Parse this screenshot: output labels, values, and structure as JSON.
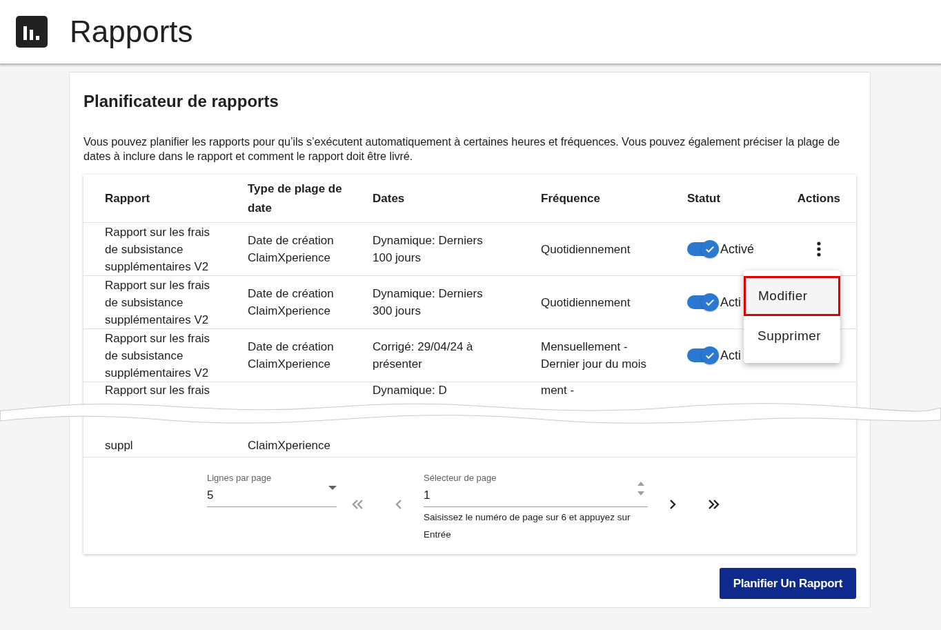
{
  "header": {
    "title": "Rapports"
  },
  "card": {
    "title": "Planificateur de rapports",
    "description": "Vous pouvez planifier les rapports pour qu’ils s’exécutent automatiquement à certaines heures et fréquences. Vous pouvez également préciser la plage de dates à inclure dans le rapport et comment le rapport doit être livré."
  },
  "table": {
    "columns": [
      "Rapport",
      "Type de plage de date",
      "Dates",
      "Fréquence",
      "Statut",
      "Actions"
    ],
    "rows": [
      {
        "report": "Rapport sur les frais de subsistance supplémentaires V2",
        "range_type": "Date de création ClaimXperience",
        "dates": "Dynamique: Derniers 100 jours",
        "frequency": "Quotidiennement",
        "status": {
          "on": true,
          "label": "Activé"
        }
      },
      {
        "report": "Rapport sur les frais de subsistance supplémentaires V2",
        "range_type": "Date de création ClaimXperience",
        "dates": "Dynamique: Derniers 300 jours",
        "frequency": "Quotidiennement",
        "status": {
          "on": true,
          "label": "Acti"
        }
      },
      {
        "report": "Rapport sur les frais de subsistance supplémentaires V2",
        "range_type": "Date de création ClaimXperience",
        "dates": "Corrigé: 29/04/24 à présenter",
        "frequency": "Mensuellement - Dernier jour du mois",
        "status": {
          "on": true,
          "label": "Acti"
        }
      }
    ],
    "torn_row": {
      "report_top": "Rapport sur les frais",
      "dates_top": "Dynamique: D",
      "frequency_top": "ment -",
      "report_bottom": "suppl",
      "range_type_bottom": "ClaimXperience"
    }
  },
  "menu": {
    "items": [
      {
        "label": "Modifier",
        "highlighted": true
      },
      {
        "label": "Supprimer",
        "highlighted": false
      }
    ]
  },
  "pagination": {
    "rows_per_page": {
      "label": "Lignes par page",
      "value": "5"
    },
    "first": {
      "disabled": true
    },
    "previous": {
      "disabled": true
    },
    "page_selector": {
      "label": "Sélecteur de page",
      "value": "1",
      "hint": "Saisissez le numéro de page sur 6 et appuyez sur Entrée"
    },
    "next": {
      "disabled": false
    },
    "last": {
      "disabled": false
    }
  },
  "primary_button": "Planifier Un Rapport"
}
